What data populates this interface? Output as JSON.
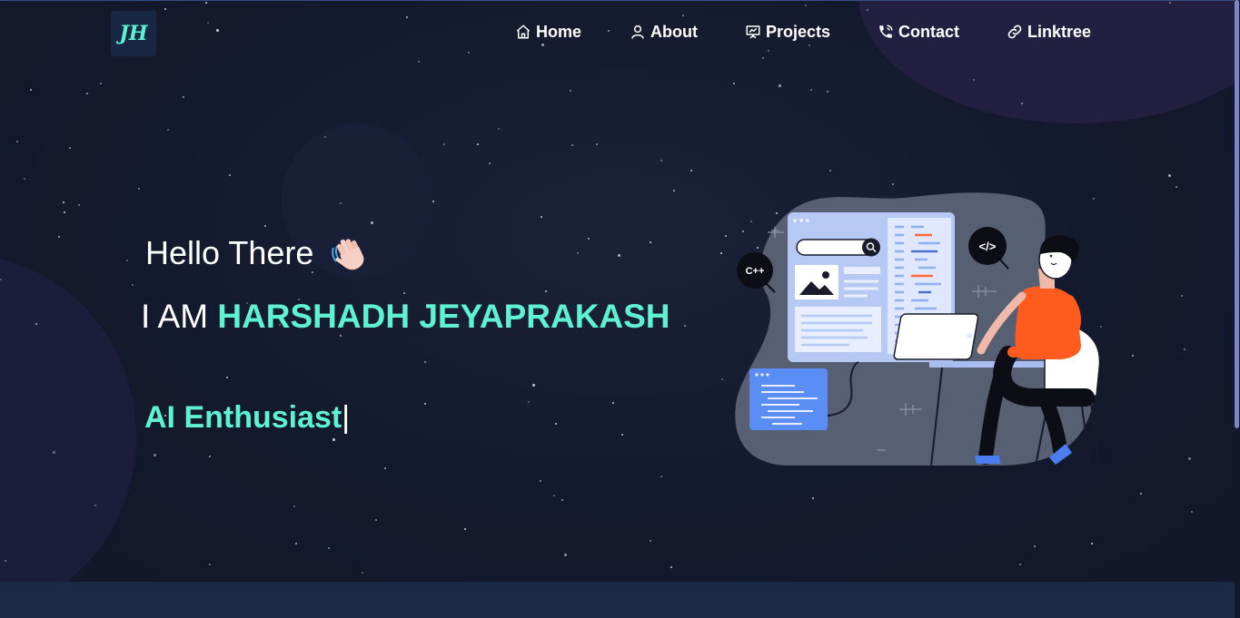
{
  "logo": {
    "text": "JH"
  },
  "nav": [
    {
      "label": "Home",
      "icon": "home-icon"
    },
    {
      "label": "About",
      "icon": "user-icon"
    },
    {
      "label": "Projects",
      "icon": "presentation-icon"
    },
    {
      "label": "Contact",
      "icon": "phone-icon"
    },
    {
      "label": "Linktree",
      "icon": "link-icon"
    }
  ],
  "hero": {
    "greeting": "Hello There",
    "greeting_icon": "waving-hand-icon",
    "iam_prefix": "I AM",
    "name": "HARSHADH JEYAPRAKASH",
    "role": "AI Enthusiast",
    "caret": "|"
  },
  "illustration": {
    "badge_cpp": "C++",
    "badge_code": "</>"
  },
  "colors": {
    "accent": "#5ef2d3",
    "background": "#171c31",
    "text": "#ffffff",
    "shirt": "#ff5b1f",
    "panel": "#b6c9f5"
  }
}
